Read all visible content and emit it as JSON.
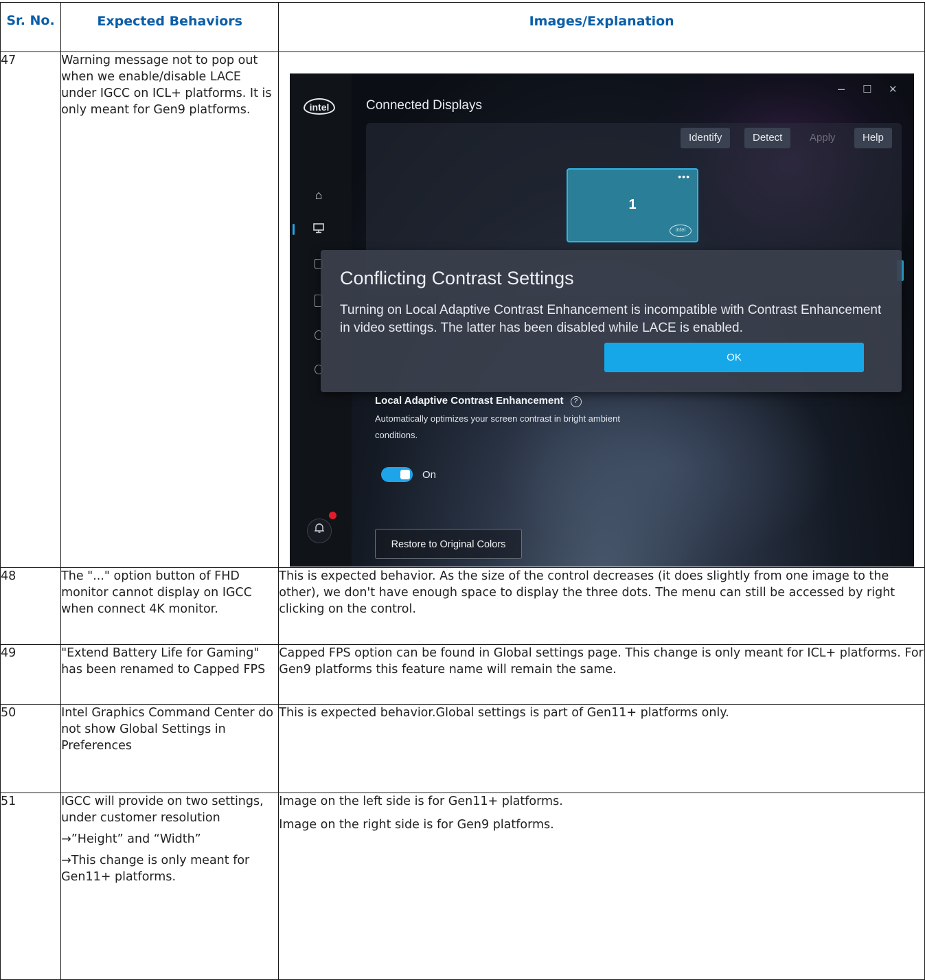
{
  "table": {
    "headers": {
      "sr_no": "Sr. No.",
      "expected": "Expected Behaviors",
      "images": "Images/Explanation"
    },
    "rows": [
      {
        "num": "47",
        "behavior": "Warning message not to pop out when we enable/disable LACE under IGCC on ICL+ platforms. It is only meant for Gen9 platforms."
      },
      {
        "num": "48",
        "behavior": "The \"...\" option button of FHD monitor cannot display on IGCC when connect 4K monitor.",
        "explanation": "This is expected behavior. As the size of the control decreases (it does slightly from one image to the other), we don't have enough space to display the three dots. The menu can still be accessed by right clicking on the control."
      },
      {
        "num": "49",
        "behavior": "\"Extend Battery Life for Gaming\" has been renamed to Capped FPS",
        "explanation": "Capped FPS option can be found in Global settings page. This change is only meant for ICL+ platforms. For Gen9 platforms this feature name will remain the same."
      },
      {
        "num": "50",
        "behavior": "Intel Graphics Command Center do not show Global Settings in Preferences",
        "explanation": "This is expected behavior.Global settings is part of Gen11+ platforms only."
      },
      {
        "num": "51",
        "behavior_lines": [
          "IGCC will provide on two settings, under customer resolution",
          "→”Height” and “Width”",
          "→This change is only meant for Gen11+ platforms."
        ],
        "explanation_lines": [
          "Image on the left side is for Gen11+ platforms.",
          "Image on the right side is for Gen9 platforms."
        ]
      }
    ]
  },
  "screenshot": {
    "logo": "intel",
    "window_controls": {
      "minimize": "–",
      "maximize": "☐",
      "close": "✕"
    },
    "page_title": "Connected Displays",
    "toolbar": {
      "identify": "Identify",
      "detect": "Detect",
      "apply": "Apply",
      "help": "Help"
    },
    "monitor": {
      "dots": "•••",
      "number": "1",
      "logo": "intel"
    },
    "dialog": {
      "title": "Conflicting Contrast Settings",
      "body": "Turning on Local Adaptive Contrast Enhancement is incompatible with Contrast Enhancement in video settings. The latter has been disabled while LACE is enabled.",
      "ok": "OK"
    },
    "lace": {
      "title": "Local Adaptive Contrast Enhancement",
      "help_icon": "?",
      "description": "Automatically optimizes your screen contrast in bright ambient conditions.",
      "toggle_state": "On"
    },
    "restore_button": "Restore to Original Colors",
    "accent_color": "#1ea4e9"
  }
}
